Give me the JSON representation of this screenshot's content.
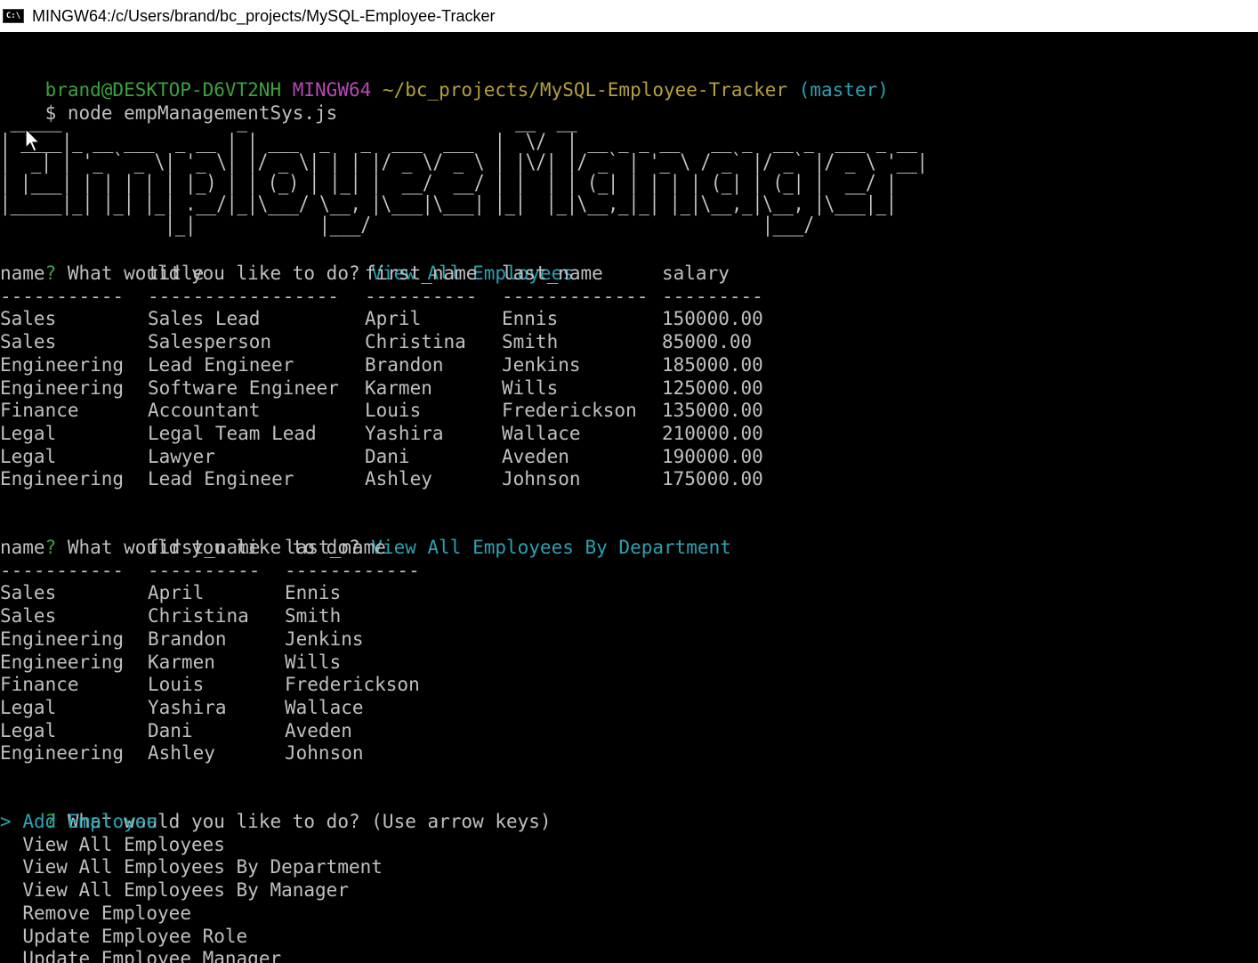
{
  "window": {
    "title": "MINGW64:/c/Users/brand/bc_projects/MySQL-Employee-Tracker",
    "icon": "console-icon"
  },
  "prompt_line": {
    "user_host": "brand@DESKTOP-D6VT2NH",
    "shell": "MINGW64",
    "path": "~/bc_projects/MySQL-Employee-Tracker",
    "branch": "(master)"
  },
  "command": {
    "symbol": "$",
    "text": "node empManagementSys.js"
  },
  "banner": {
    "text": "Employee Manager",
    "ascii": " _____                 _                          __  __\n| ____|_ __ ___  _ __ | | ___  _   _  ___  ___  |  \\/  | __ _ _ __   __ _  __ _  ___ _ __\n|  _| | '_ ` _ \\| '_ \\| |/ _ \\| | | |/ _ \\/ _ \\ | |\\/| |/ _` | '_ \\ / _` |/ _` |/ _ \\ '__|\n| |___| | | | | | |_) | | (_) | |_| |  __/  __/ | |  | | (_| | | | | (_| | (_| |  __/ |\n|_____|_| |_| |_| .__/|_|\\___/ \\__, |\\___|\\___| |_|  |_|\\__,_|_| |_|\\__,_|\\__, |\\___|_|\n                |_|            |___/                                      |___/"
  },
  "question_text": "What would you like to do?",
  "question_mark": "?",
  "q1": {
    "answer": "View All Employees"
  },
  "table1": {
    "headers": [
      "name",
      "title",
      "first_name",
      "last_name",
      "salary"
    ],
    "dashes": [
      "-----------",
      "-----------------",
      "----------",
      "-------------",
      "---------"
    ],
    "rows": [
      [
        "Sales",
        "Sales Lead",
        "April",
        "Ennis",
        "150000.00"
      ],
      [
        "Sales",
        "Salesperson",
        "Christina",
        "Smith",
        "85000.00"
      ],
      [
        "Engineering",
        "Lead Engineer",
        "Brandon",
        "Jenkins",
        "185000.00"
      ],
      [
        "Engineering",
        "Software Engineer",
        "Karmen",
        "Wills",
        "125000.00"
      ],
      [
        "Finance",
        "Accountant",
        "Louis",
        "Frederickson",
        "135000.00"
      ],
      [
        "Legal",
        "Legal Team Lead",
        "Yashira",
        "Wallace",
        "210000.00"
      ],
      [
        "Legal",
        "Lawyer",
        "Dani",
        "Aveden",
        "190000.00"
      ],
      [
        "Engineering",
        "Lead Engineer",
        "Ashley",
        "Johnson",
        "175000.00"
      ]
    ]
  },
  "q2": {
    "answer": "View All Employees By Department"
  },
  "table2": {
    "headers": [
      "name",
      "first_name",
      "last_name"
    ],
    "dashes": [
      "-----------",
      "----------",
      "------------"
    ],
    "rows": [
      [
        "Sales",
        "April",
        "Ennis"
      ],
      [
        "Sales",
        "Christina",
        "Smith"
      ],
      [
        "Engineering",
        "Brandon",
        "Jenkins"
      ],
      [
        "Engineering",
        "Karmen",
        "Wills"
      ],
      [
        "Finance",
        "Louis",
        "Frederickson"
      ],
      [
        "Legal",
        "Yashira",
        "Wallace"
      ],
      [
        "Legal",
        "Dani",
        "Aveden"
      ],
      [
        "Engineering",
        "Ashley",
        "Johnson"
      ]
    ]
  },
  "q3": {
    "hint": "(Use arrow keys)"
  },
  "menu": {
    "pointer": ">",
    "items": [
      "Add Employee",
      "View All Employees",
      "View All Employees By Department",
      "View All Employees By Manager",
      "Remove Employee",
      "Update Employee Role",
      "Update Employee Manager"
    ],
    "selected_index": 0
  },
  "colors": {
    "green": "#3ca33c",
    "magenta": "#b648b6",
    "yellow": "#b5a13a",
    "cyan": "#2aa1b3",
    "text": "#c0c0c0",
    "background": "#000000"
  }
}
